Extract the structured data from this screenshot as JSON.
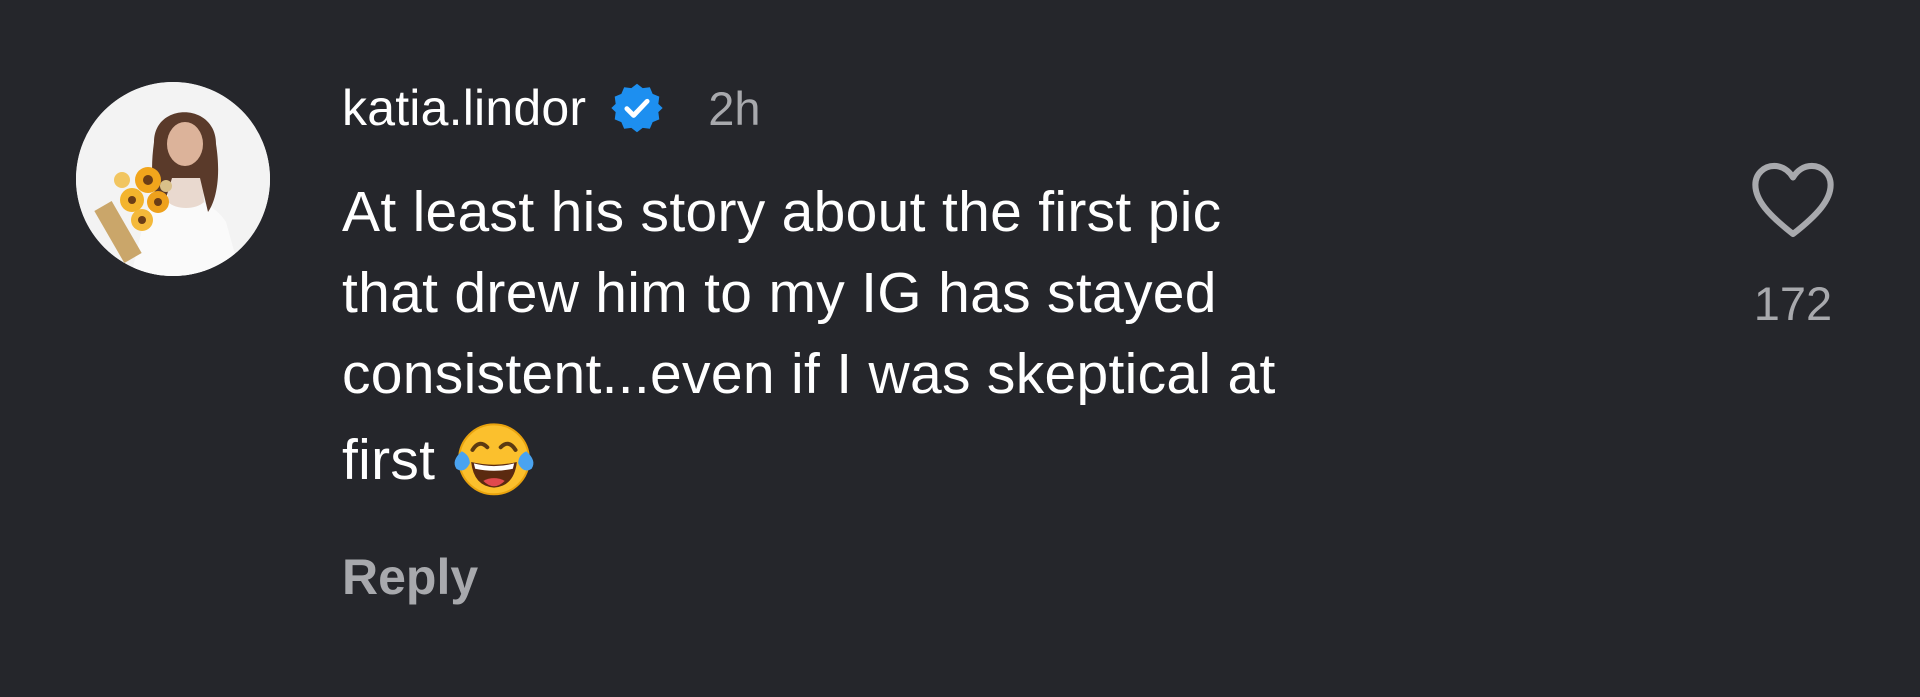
{
  "comment": {
    "username": "katia.lindor",
    "timestamp": "2h",
    "lines": [
      "At least his story about the first pic",
      "that drew him to my IG has stayed",
      "consistent...even if I was skeptical at",
      "first"
    ],
    "emoji": "face-with-tears-of-joy",
    "reply_label": "Reply",
    "like_count": "172"
  },
  "colors": {
    "background": "#25262b",
    "text_primary": "#ffffff",
    "text_secondary": "#a8a9ad",
    "verified_badge": "#1d8ff0"
  },
  "icons": {
    "avatar": "profile-photo",
    "verified": "verified-badge-icon",
    "like": "heart-outline-icon"
  }
}
